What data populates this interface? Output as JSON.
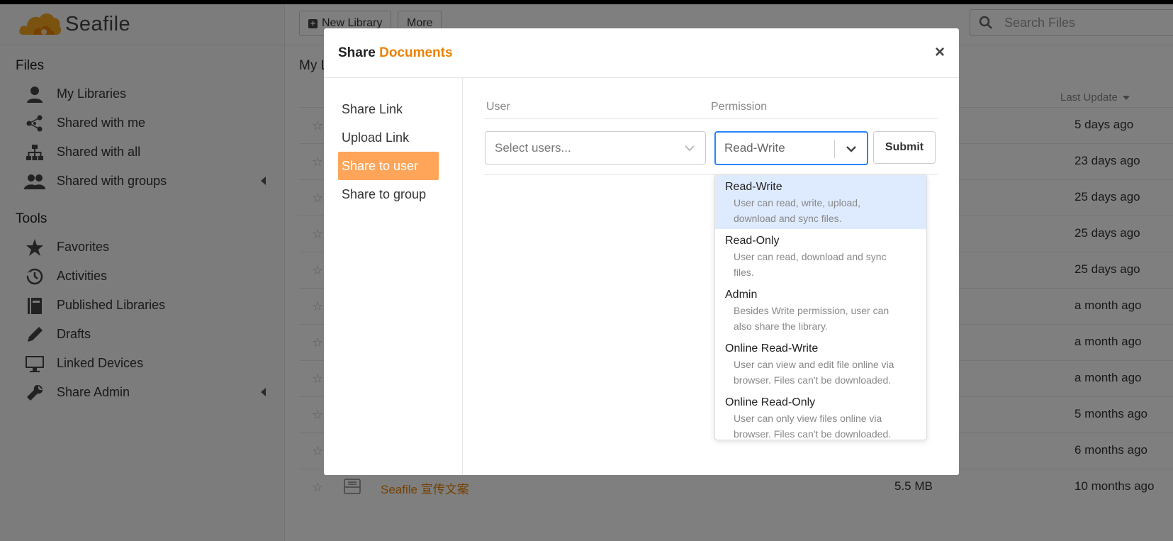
{
  "sidebar": {
    "logo_text": "Seafile",
    "files_heading": "Files",
    "files_items": [
      {
        "label": "My Libraries"
      },
      {
        "label": "Shared with me"
      },
      {
        "label": "Shared with all"
      },
      {
        "label": "Shared with groups"
      }
    ],
    "tools_heading": "Tools",
    "tools_items": [
      {
        "label": "Favorites"
      },
      {
        "label": "Activities"
      },
      {
        "label": "Published Libraries"
      },
      {
        "label": "Drafts"
      },
      {
        "label": "Linked Devices"
      },
      {
        "label": "Share Admin"
      }
    ]
  },
  "topbar": {
    "new_library_label": "New Library",
    "more_label": "More",
    "search_placeholder": "Search Files"
  },
  "main": {
    "title": "My L",
    "last_update_header": "Last Update",
    "rows": [
      {
        "updated": "5 days ago"
      },
      {
        "updated": "23 days ago"
      },
      {
        "updated": "25 days ago"
      },
      {
        "updated": "25 days ago"
      },
      {
        "updated": "25 days ago"
      },
      {
        "updated": "a month ago"
      },
      {
        "updated": "a month ago"
      },
      {
        "updated": "a month ago"
      },
      {
        "updated": "5 months ago"
      },
      {
        "updated": "6 months ago"
      },
      {
        "name": "Seafile 宣传文案",
        "size": "5.5 MB",
        "updated": "10 months ago"
      }
    ]
  },
  "modal": {
    "title_prefix": "Share",
    "title_name": "Documents",
    "close_label": "×",
    "nav": [
      {
        "label": "Share Link"
      },
      {
        "label": "Upload Link"
      },
      {
        "label": "Share to user"
      },
      {
        "label": "Share to group"
      }
    ],
    "form": {
      "user_header": "User",
      "permission_header": "Permission",
      "user_placeholder": "Select users...",
      "permission_value": "Read-Write",
      "submit_label": "Submit"
    },
    "permission_options": [
      {
        "title": "Read-Write",
        "desc1": "User can read, write, upload,",
        "desc2": "download and sync files."
      },
      {
        "title": "Read-Only",
        "desc1": "User can read, download and sync",
        "desc2": "files."
      },
      {
        "title": "Admin",
        "desc1": "Besides Write permission, user can",
        "desc2": "also share the library."
      },
      {
        "title": "Online Read-Write",
        "desc1": "User can view and edit file online via",
        "desc2": "browser. Files can't be downloaded."
      },
      {
        "title": "Online Read-Only",
        "desc1": "User can only view files online via",
        "desc2": "browser. Files can't be downloaded."
      }
    ]
  },
  "colors": {
    "accent": "#eb8205",
    "active_nav": "#fea55a",
    "focus_border": "#2684ff",
    "selected_option": "#deebff"
  }
}
